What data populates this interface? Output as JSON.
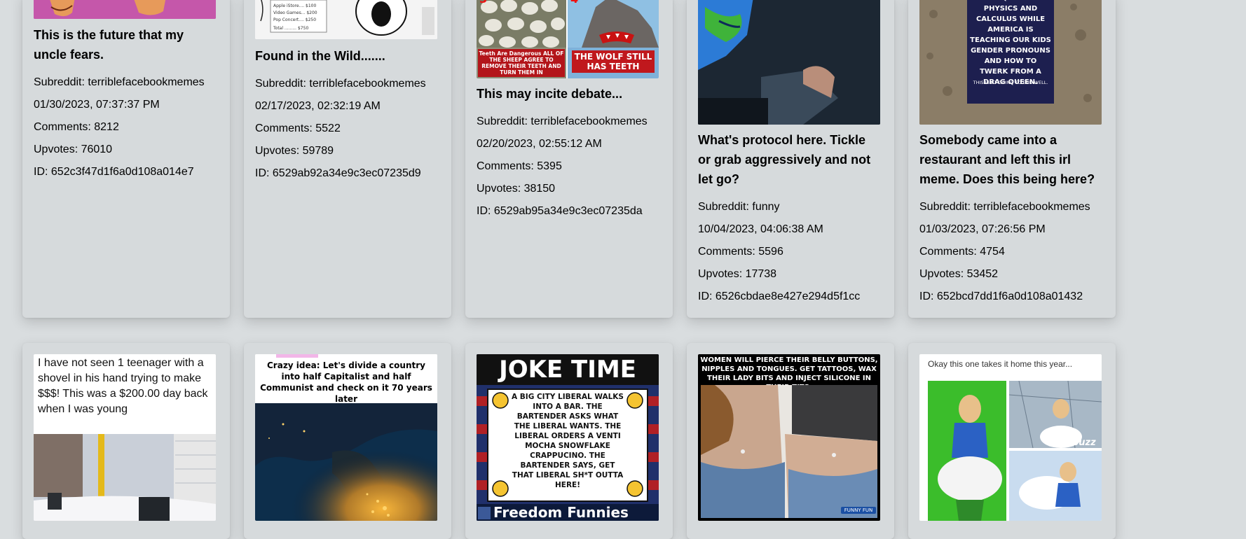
{
  "posts_row1": [
    {
      "title": "This is the future that my uncle fears.",
      "subreddit": "Subreddit: terriblefacebookmemes",
      "date": "01/30/2023, 07:37:37 PM",
      "comments": "Comments: 8212",
      "upvotes": "Upvotes: 76010",
      "id": "ID: 652c3f47d1f6a0d108a014e7"
    },
    {
      "title": "Found in the Wild.......",
      "subreddit": "Subreddit: terriblefacebookmemes",
      "date": "02/17/2023, 02:32:19 AM",
      "comments": "Comments: 5522",
      "upvotes": "Upvotes: 59789",
      "id": "ID: 6529ab92a34e9c3ec07235d9"
    },
    {
      "title": "This may incite debate...",
      "subreddit": "Subreddit: terriblefacebookmemes",
      "date": "02/20/2023, 02:55:12 AM",
      "comments": "Comments: 5395",
      "upvotes": "Upvotes: 38150",
      "id": "ID: 6529ab95a34e9c3ec07235da",
      "image_text_left": "Teeth Are Dangerous ALL OF THE SHEEP AGREE TO REMOVE THEIR TEETH AND TURN THEM IN",
      "image_text_right": "THE WOLF STILL HAS TEETH"
    },
    {
      "title": "What's protocol here. Tickle or grab aggressively and not let go?",
      "subreddit": "Subreddit: funny",
      "date": "10/04/2023, 04:06:38 AM",
      "comments": "Comments: 5596",
      "upvotes": "Upvotes: 17738",
      "id": "ID: 6526cbdae8e427e294d5f1cc"
    },
    {
      "title": "Somebody came into a restaurant and left this irl meme. Does this being here?",
      "subreddit": "Subreddit: terriblefacebookmemes",
      "date": "01/03/2023, 07:26:56 PM",
      "comments": "Comments: 4754",
      "upvotes": "Upvotes: 53452",
      "id": "ID: 652bcd7dd1f6a0d108a01432",
      "image_text": "KIDS QUANTUM PHYSICS AND CALCULUS WHILE AMERICA IS TEACHING OUR KIDS GENDER PRONOUNS AND HOW TO TWERK FROM A DRAG QUEEN.",
      "image_subtext": "THIS ISN'T GOING TO END WELL."
    }
  ],
  "posts_row2": [
    {
      "image_text": "I have not seen 1 teenager with a shovel in his hand trying to make $$$! This was a $200.00 day back when I was young"
    },
    {
      "image_text": "Crazy idea: Let's divide a country into half Capitalist and half Communist and check on it 70 years later"
    },
    {
      "image_heading": "JOKE TIME",
      "image_text": "A BIG CITY LIBERAL WALKS INTO A BAR. THE BARTENDER ASKS WHAT THE LIBERAL WANTS. THE LIBERAL ORDERS A VENTI MOCHA SNOWFLAKE CRAPPUCINO. THE BARTENDER SAYS, GET THAT LIBERAL SH*T OUTTA HERE!",
      "image_footer": "Freedom Funnies"
    },
    {
      "image_text": "WOMEN WILL PIERCE THEIR BELLY BUTTONS, NIPPLES AND TONGUES. GET TATTOOS, WAX THEIR LADY BITS AND INJECT SILICONE IN THEIR TITS.",
      "image_badge": "FUNNY FUN"
    },
    {
      "image_text": "Okay this one takes it home this year...",
      "image_badge": "buzz"
    }
  ]
}
